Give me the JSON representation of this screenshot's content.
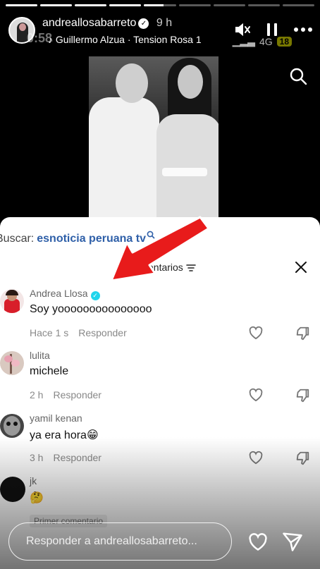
{
  "story": {
    "progress": [
      1,
      1,
      1,
      1,
      0.6,
      0,
      0,
      0,
      0
    ],
    "username": "andreallosabarreto",
    "age": "9 h",
    "status_time": "0:58",
    "music": "Guillermo Alzua · Tension Rosa 1",
    "network": "4G",
    "battery": "18"
  },
  "search": {
    "prefix": "Buscar:",
    "term": "esnoticia peruana tv"
  },
  "comments_sheet": {
    "title": "entarios",
    "comments": [
      {
        "user": "Andrea Llosa",
        "verified": true,
        "text": "Soy yooooooooooooooo",
        "time": "Hace 1 s",
        "reply": "Responder"
      },
      {
        "user": "lulita",
        "verified": false,
        "text": "michele",
        "time": "2 h",
        "reply": "Responder"
      },
      {
        "user": "yamil kenan",
        "verified": false,
        "text": "ya era hora😁",
        "time": "3 h",
        "reply": "Responder"
      },
      {
        "user": "jk",
        "verified": false,
        "text": "🤔",
        "time": "",
        "reply": ""
      }
    ],
    "first_comment_tag": "Primer comentario"
  },
  "reply_bar": {
    "placeholder": "Responder a andreallosabarreto..."
  },
  "colors": {
    "sheet_bg": "#ffffff",
    "search_term": "#2e5fa8",
    "verified_badge": "#20d5ec",
    "arrow": "#e81b1b"
  }
}
